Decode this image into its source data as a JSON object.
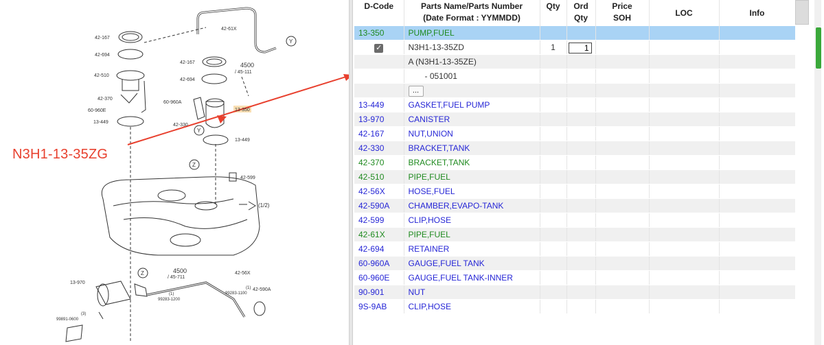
{
  "diagram": {
    "callout_part_number": "N3H1-13-35ZG",
    "labels": [
      "42-167",
      "42-694",
      "42-510",
      "42-370",
      "60-960E",
      "13-449",
      "42-61X",
      "42-167",
      "42-694",
      "60-960A",
      "42-330",
      "13-350",
      "13-449",
      "4500",
      "/ 45-111",
      "42-599",
      "(1/2)",
      "4500",
      "/ 45-711",
      "42-56X",
      "13-970",
      "99283-1100",
      "(1)",
      "42-590A",
      "99283-1200",
      "(1)",
      "(3)",
      "99891-0600"
    ],
    "markers": [
      "Y",
      "Y",
      "Z",
      "Z"
    ]
  },
  "table": {
    "headers": {
      "dcode": "D-Code",
      "parts_line1": "Parts Name/Parts Number",
      "parts_line2": "(Date Format : YYMMDD)",
      "qty": "Qty",
      "ord_line1": "Ord",
      "ord_line2": "Qty",
      "price_line1": "Price",
      "price_line2": "SOH",
      "loc": "LOC",
      "info": "Info"
    },
    "selected_row": {
      "code": "13-350",
      "name": "PUMP,FUEL"
    },
    "detail": {
      "checkbox_glyph": "✓",
      "part_number": "N3H1-13-35ZD",
      "qty": "1",
      "ord_qty": "1",
      "alt_line": "A (N3H1-13-35ZE)",
      "date_line": "- 051001",
      "more_button": "..."
    },
    "rows": [
      {
        "code": "13-449",
        "name": "GASKET,FUEL PUMP",
        "color": "blue"
      },
      {
        "code": "13-970",
        "name": "CANISTER",
        "color": "blue"
      },
      {
        "code": "42-167",
        "name": "NUT,UNION",
        "color": "blue"
      },
      {
        "code": "42-330",
        "name": "BRACKET,TANK",
        "color": "blue"
      },
      {
        "code": "42-370",
        "name": "BRACKET,TANK",
        "color": "green"
      },
      {
        "code": "42-510",
        "name": "PIPE,FUEL",
        "color": "green"
      },
      {
        "code": "42-56X",
        "name": "HOSE,FUEL",
        "color": "blue"
      },
      {
        "code": "42-590A",
        "name": "CHAMBER,EVAPO-TANK",
        "color": "blue"
      },
      {
        "code": "42-599",
        "name": "CLIP,HOSE",
        "color": "blue"
      },
      {
        "code": "42-61X",
        "name": "PIPE,FUEL",
        "color": "green"
      },
      {
        "code": "42-694",
        "name": "RETAINER",
        "color": "blue"
      },
      {
        "code": "60-960A",
        "name": "GAUGE,FUEL TANK",
        "color": "blue"
      },
      {
        "code": "60-960E",
        "name": "GAUGE,FUEL TANK-INNER",
        "color": "blue"
      },
      {
        "code": "90-901",
        "name": "NUT",
        "color": "blue"
      },
      {
        "code": "9S-9AB",
        "name": "CLIP,HOSE",
        "color": "blue"
      }
    ]
  },
  "colors": {
    "green": "#1f8a1f",
    "blue": "#2626d6",
    "selected": "#a9d3f5",
    "callout": "#e8402e"
  }
}
